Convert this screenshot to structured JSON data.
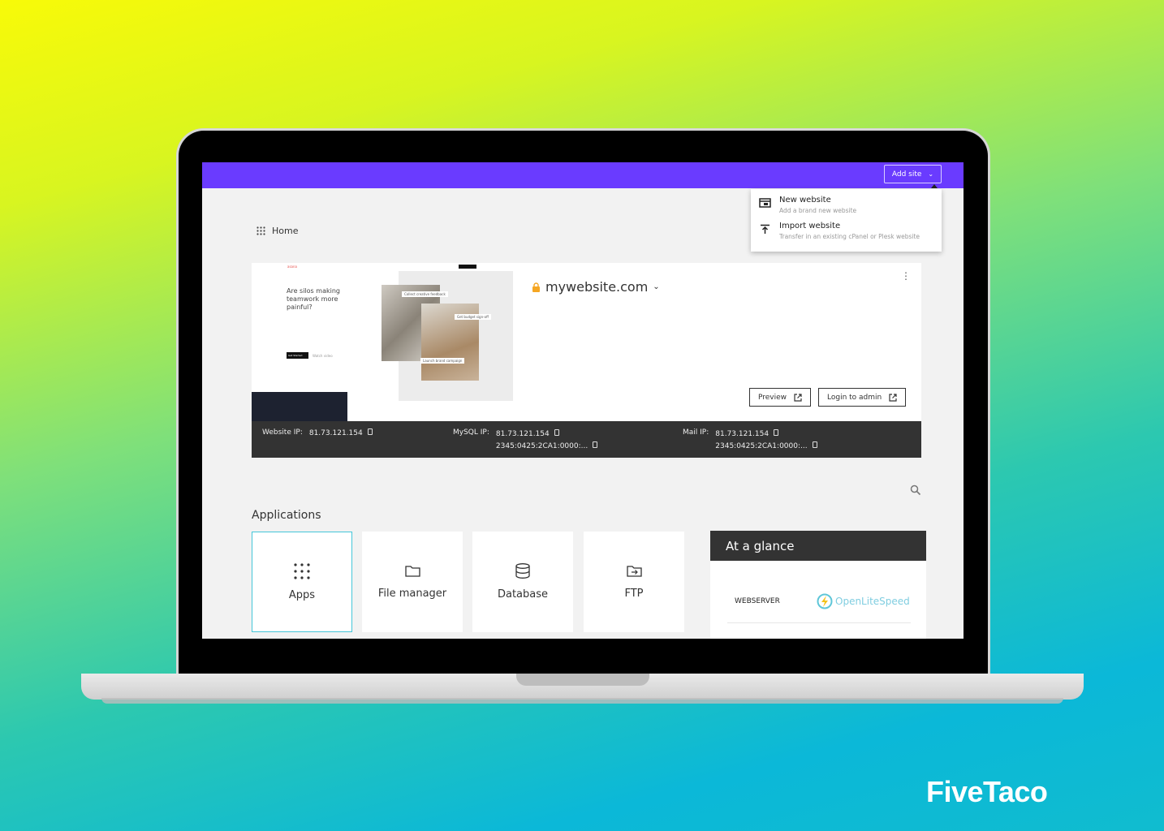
{
  "topbar": {
    "add_site_label": "Add site"
  },
  "dropdown": {
    "items": [
      {
        "icon": "browser-window-icon",
        "title": "New website",
        "subtitle": "Add a brand new website"
      },
      {
        "icon": "upload-icon",
        "title": "Import website",
        "subtitle": "Transfer in an existing cPanel or Plesk website"
      }
    ]
  },
  "breadcrumb": {
    "label": "Home"
  },
  "site": {
    "domain": "mywebsite.com",
    "preview_label": "Preview",
    "login_label": "Login to admin",
    "thumbnail": {
      "headline": "Are silos making teamwork more painful?",
      "brand": "asana",
      "cta": "Get Started",
      "watch": "Watch video",
      "tags": [
        "Collect creative feedback",
        "Get budget sign-off",
        "Launch brand campaign"
      ]
    }
  },
  "ips": {
    "website": {
      "label": "Website IP:",
      "value": "81.73.121.154"
    },
    "mysql": {
      "label": "MySQL IP:",
      "value": "81.73.121.154",
      "ipv6": "2345:0425:2CA1:0000:..."
    },
    "mail": {
      "label": "Mail IP:",
      "value": "81.73.121.154",
      "ipv6": "2345:0425:2CA1:0000:..."
    }
  },
  "applications": {
    "title": "Applications",
    "tiles": [
      {
        "label": "Apps",
        "icon": "grid-icon"
      },
      {
        "label": "File manager",
        "icon": "folder-icon"
      },
      {
        "label": "Database",
        "icon": "database-icon"
      },
      {
        "label": "FTP",
        "icon": "ftp-folder-icon"
      }
    ]
  },
  "glance": {
    "title": "At a glance",
    "rows": [
      {
        "label": "WEBSERVER",
        "value": "OpenLiteSpeed"
      }
    ]
  },
  "brand": {
    "logo": "FiveTaco"
  },
  "colors": {
    "topbar": "#6a3bff",
    "selected_tile": "#45c6d9",
    "ip_bar": "#333333",
    "lock": "#f5a623"
  }
}
